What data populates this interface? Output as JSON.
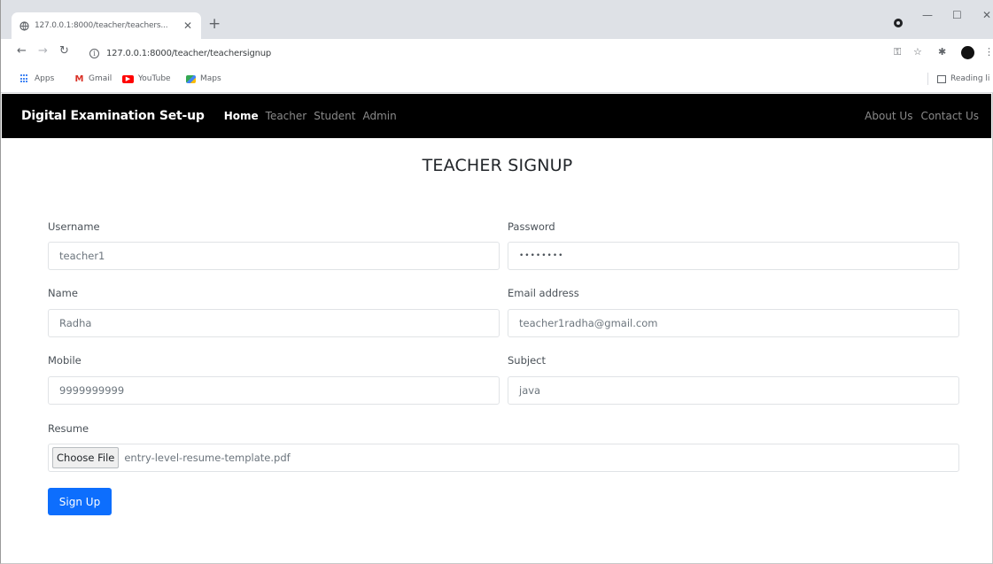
{
  "browser": {
    "tab_title": "127.0.0.1:8000/teacher/teachers...",
    "tab_close": "✕",
    "new_tab": "+",
    "url": "127.0.0.1:8000/teacher/teachersignup",
    "bookmarks": [
      {
        "label": "Apps"
      },
      {
        "label": "Gmail"
      },
      {
        "label": "YouTube"
      },
      {
        "label": "Maps"
      }
    ],
    "reading_list": "Reading li"
  },
  "navbar": {
    "brand": "Digital Examination Set-up",
    "links": [
      {
        "label": "Home",
        "active": true
      },
      {
        "label": "Teacher"
      },
      {
        "label": "Student"
      },
      {
        "label": "Admin"
      }
    ],
    "right_links": [
      {
        "label": "About Us"
      },
      {
        "label": "Contact Us"
      }
    ]
  },
  "form": {
    "title": "TEACHER SIGNUP",
    "username": {
      "label": "Username",
      "value": "teacher1"
    },
    "password": {
      "label": "Password",
      "value": "••••••••"
    },
    "name": {
      "label": "Name",
      "value": "Radha"
    },
    "email": {
      "label": "Email address",
      "value": "teacher1radha@gmail.com"
    },
    "mobile": {
      "label": "Mobile",
      "value": "9999999999"
    },
    "subject": {
      "label": "Subject",
      "value": "java"
    },
    "resume": {
      "label": "Resume",
      "button": "Choose File",
      "file": "entry-level-resume-template.pdf"
    },
    "submit": "Sign Up"
  },
  "colors": {
    "navbar_bg": "#000000",
    "primary_button": "#0d6efd"
  }
}
